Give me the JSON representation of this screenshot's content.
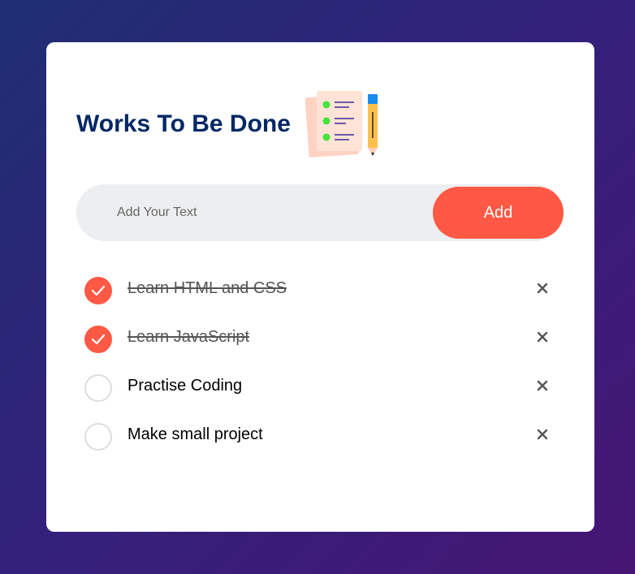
{
  "app": {
    "title": "Works To Be Done",
    "icon": "checklist-with-pencil-icon"
  },
  "input": {
    "placeholder": "Add Your Text",
    "value": "",
    "add_label": "Add"
  },
  "tasks": [
    {
      "text": "Learn HTML and CSS",
      "done": true
    },
    {
      "text": "Learn JavaScript",
      "done": true
    },
    {
      "text": "Practise Coding",
      "done": false
    },
    {
      "text": "Make small project",
      "done": false
    }
  ],
  "colors": {
    "accent": "#ff5945",
    "title": "#002765",
    "background_start": "#1f2f73",
    "background_end": "#461673"
  }
}
